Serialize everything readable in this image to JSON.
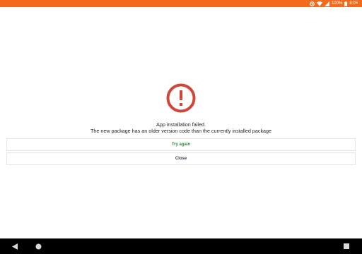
{
  "status_bar": {
    "battery": "100%",
    "time": "8:05",
    "icons": [
      "data-saver-icon",
      "wifi-icon",
      "cellular-icon",
      "battery-icon"
    ],
    "bg_color": "#f26b1d"
  },
  "dialog": {
    "icon": "error-icon",
    "icon_color": "#d0463b",
    "title": "App installation failed.",
    "message": "The new package has an older version code than the currently installed package",
    "try_again_label": "Try again",
    "try_again_color": "#2e8b3a",
    "close_label": "Close",
    "close_color": "#2f3f57"
  },
  "nav_bar": {
    "buttons": [
      "back-icon",
      "home-icon",
      "recents-icon"
    ]
  }
}
